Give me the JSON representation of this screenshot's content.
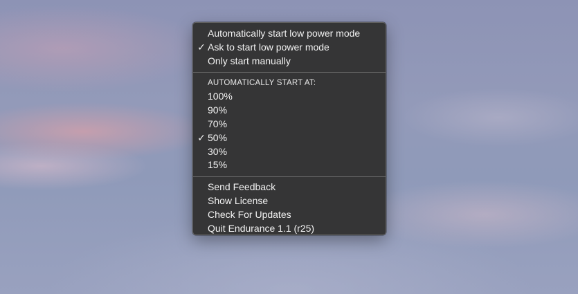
{
  "menu": {
    "mode_items": [
      {
        "label": "Automatically start low power mode",
        "checked": false
      },
      {
        "label": "Ask to start low power mode",
        "checked": true
      },
      {
        "label": "Only start manually",
        "checked": false
      }
    ],
    "threshold_header": "AUTOMATICALLY START AT:",
    "threshold_items": [
      {
        "label": "100%",
        "checked": false
      },
      {
        "label": "90%",
        "checked": false
      },
      {
        "label": "70%",
        "checked": false
      },
      {
        "label": "50%",
        "checked": true
      },
      {
        "label": "30%",
        "checked": false
      },
      {
        "label": "15%",
        "checked": false
      }
    ],
    "app_items": [
      {
        "label": "Send Feedback"
      },
      {
        "label": "Show License"
      },
      {
        "label": "Check For Updates"
      },
      {
        "label": "Quit Endurance 1.1 (r25)"
      }
    ],
    "check_glyph": "✓"
  }
}
